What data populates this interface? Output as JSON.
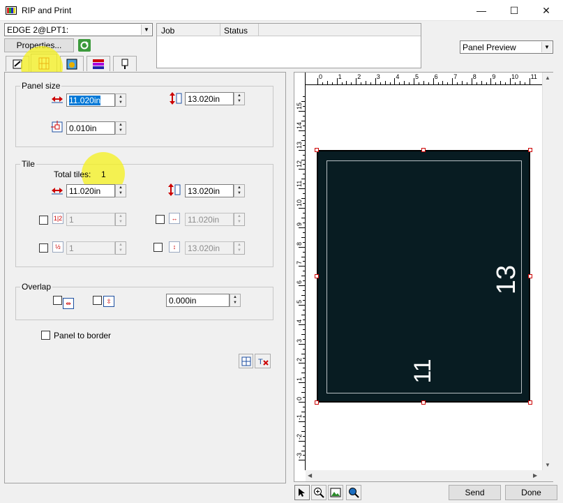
{
  "window": {
    "title": "RIP and Print",
    "minimize_glyph": "—",
    "maximize_glyph": "☐",
    "close_glyph": "✕"
  },
  "printer": {
    "selected": "EDGE 2@LPT1:",
    "properties_label": "Properties..."
  },
  "job_table": {
    "columns": [
      "Job",
      "Status"
    ]
  },
  "preview_mode": {
    "selected": "Panel Preview"
  },
  "tabs": [
    {
      "icon": "print-settings-icon",
      "active": false
    },
    {
      "icon": "panel-grid-icon",
      "active": true
    },
    {
      "icon": "color-image-icon",
      "active": false
    },
    {
      "icon": "color-bars-icon",
      "active": false
    },
    {
      "icon": "cutter-tool-icon",
      "active": false
    }
  ],
  "panel_size": {
    "label": "Panel size",
    "width": "11.020in",
    "height": "13.020in",
    "margin": "0.010in"
  },
  "tile": {
    "label": "Tile",
    "total_tiles_label": "Total tiles:",
    "total_tiles_value": "1",
    "width": "11.020in",
    "height": "13.020in",
    "columns": "1",
    "tile_width": "11.020in",
    "rows": "1",
    "tile_height": "13.020in"
  },
  "overlap": {
    "label": "Overlap",
    "value": "0.000in"
  },
  "panel_to_border_label": "Panel to border",
  "preview": {
    "width_label": "11",
    "height_label": "13",
    "h_ruler": [
      "0",
      "1",
      "2",
      "3",
      "4",
      "5",
      "6",
      "7",
      "8",
      "9",
      "10",
      "11"
    ],
    "v_ruler": [
      "-3",
      "-2",
      "-1",
      "0",
      "1",
      "2",
      "3",
      "4",
      "5",
      "6",
      "7",
      "8",
      "9",
      "10",
      "11",
      "12",
      "13",
      "14",
      "15"
    ],
    "panel_color": "#081c22"
  },
  "actions": {
    "send_label": "Send",
    "done_label": "Done"
  },
  "colors": {
    "highlight": "#f5f21c",
    "selection": "#0078d7"
  }
}
